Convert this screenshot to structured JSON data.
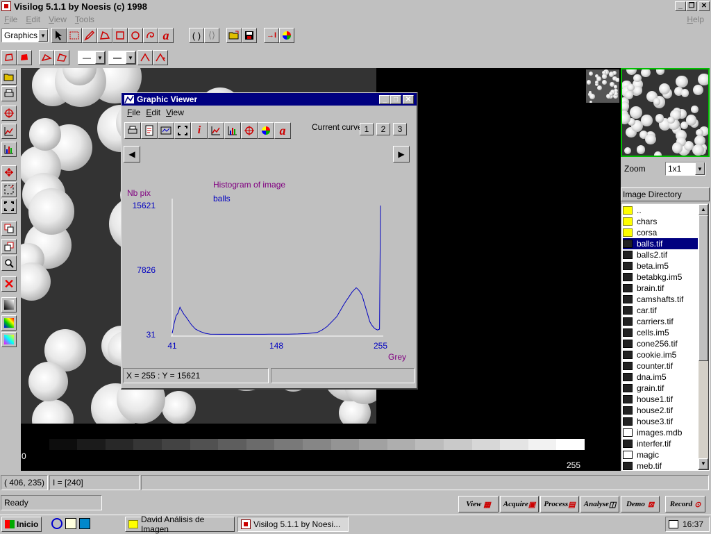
{
  "app": {
    "title": "Visilog 5.1.1 by Noesis (c) 1998",
    "menu": [
      "File",
      "Edit",
      "View",
      "Tools"
    ],
    "help": "Help",
    "mode_select": "Graphics"
  },
  "graphic_viewer": {
    "title": "Graphic Viewer",
    "menu": [
      "File",
      "Edit",
      "View"
    ],
    "current_curve_label": "Current curve",
    "curve_buttons": [
      "1",
      "2",
      "3"
    ],
    "status_left": "X = 255 : Y = 15621",
    "status_right": ""
  },
  "chart_data": {
    "type": "line",
    "title": "Histogram of image",
    "subtitle": "balls",
    "ylabel": "Nb pix",
    "xlabel": "Grey",
    "xlim": [
      41,
      255
    ],
    "ylim": [
      31,
      15621
    ],
    "x_ticks": [
      "41",
      "148",
      "255"
    ],
    "y_ticks": [
      "15621",
      "7826",
      "31"
    ],
    "color": "#0000c0",
    "series": [
      {
        "x": [
          41,
          43,
          45,
          47,
          49,
          51,
          53,
          55,
          58,
          61,
          65,
          70,
          75,
          80,
          90,
          100,
          110,
          120,
          130,
          140,
          150,
          160,
          170,
          180,
          190,
          195,
          200,
          205,
          210,
          214,
          218,
          222,
          226,
          230,
          232,
          234,
          236,
          238,
          240,
          242,
          244,
          246,
          248,
          250,
          252,
          254,
          255
        ],
        "y": [
          200,
          1400,
          2300,
          2650,
          3350,
          2900,
          2500,
          2200,
          1700,
          1200,
          700,
          400,
          200,
          100,
          80,
          80,
          80,
          80,
          80,
          90,
          90,
          100,
          120,
          180,
          300,
          600,
          1000,
          1600,
          2200,
          3000,
          3800,
          4500,
          5200,
          5700,
          5500,
          5200,
          4800,
          4000,
          3200,
          2400,
          1600,
          1200,
          900,
          700,
          600,
          700,
          15621
        ]
      }
    ]
  },
  "image_view": {
    "ramp_min": "0",
    "ramp_max": "255"
  },
  "right_panel": {
    "zoom_label": "Zoom",
    "zoom_value": "1x1",
    "dir_header": "Image Directory",
    "items": [
      {
        "name": "..",
        "kind": "folder"
      },
      {
        "name": "chars",
        "kind": "folder"
      },
      {
        "name": "corsa",
        "kind": "folder"
      },
      {
        "name": "balls.tif",
        "kind": "image",
        "selected": true
      },
      {
        "name": "balls2.tif",
        "kind": "image"
      },
      {
        "name": "beta.im5",
        "kind": "image"
      },
      {
        "name": "betabkg.im5",
        "kind": "image"
      },
      {
        "name": "brain.tif",
        "kind": "image"
      },
      {
        "name": "camshafts.tif",
        "kind": "image"
      },
      {
        "name": "car.tif",
        "kind": "image"
      },
      {
        "name": "carriers.tif",
        "kind": "image"
      },
      {
        "name": "cells.im5",
        "kind": "image"
      },
      {
        "name": "cone256.tif",
        "kind": "image"
      },
      {
        "name": "cookie.im5",
        "kind": "image"
      },
      {
        "name": "counter.tif",
        "kind": "image"
      },
      {
        "name": "dna.im5",
        "kind": "image"
      },
      {
        "name": "grain.tif",
        "kind": "image"
      },
      {
        "name": "house1.tif",
        "kind": "image"
      },
      {
        "name": "house2.tif",
        "kind": "image"
      },
      {
        "name": "house3.tif",
        "kind": "image"
      },
      {
        "name": "images.mdb",
        "kind": "doc"
      },
      {
        "name": "interfer.tif",
        "kind": "image"
      },
      {
        "name": "magic",
        "kind": "doc"
      },
      {
        "name": "meb.tif",
        "kind": "image"
      }
    ]
  },
  "status": {
    "coords": "( 406, 235)",
    "intensity": "I = [240]",
    "ready": "Ready"
  },
  "mode_buttons": [
    "View",
    "Acquire",
    "Process",
    "Analyse",
    "Demo",
    "Record"
  ],
  "taskbar": {
    "start": "Inicio",
    "tasks": [
      "David Análisis de Imagen",
      "Visilog 5.1.1 by Noesi..."
    ],
    "clock": "16:37"
  }
}
